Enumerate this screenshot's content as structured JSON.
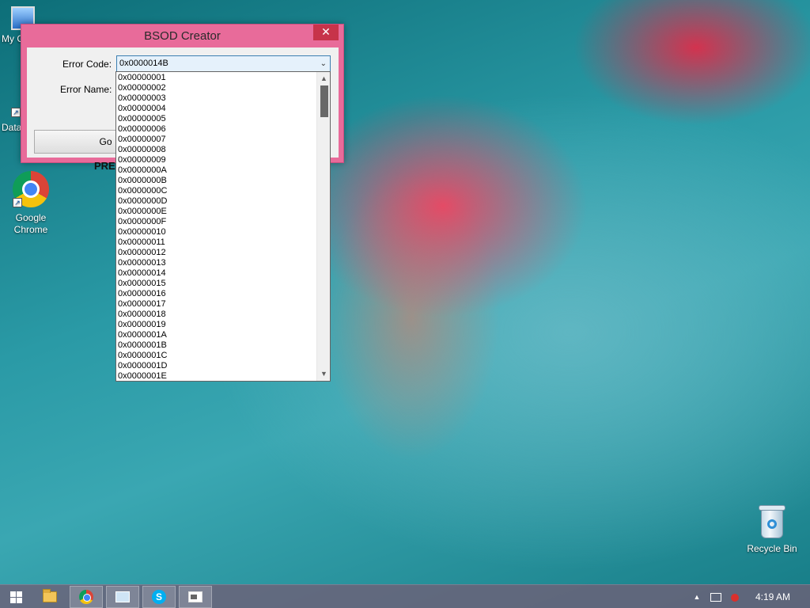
{
  "desktop": {
    "icons": [
      {
        "label": "My C"
      },
      {
        "label": "Data"
      },
      {
        "label": "Google Chrome"
      },
      {
        "label": "Recycle Bin"
      }
    ]
  },
  "window": {
    "title": "BSOD Creator",
    "close_glyph": "✕",
    "error_code_label": "Error Code:",
    "error_name_label": "Error Name:",
    "error_code_value": "0x0000014B",
    "go_label": "Go",
    "press_text": "PRES"
  },
  "dropdown": {
    "items": [
      "0x00000001",
      "0x00000002",
      "0x00000003",
      "0x00000004",
      "0x00000005",
      "0x00000006",
      "0x00000007",
      "0x00000008",
      "0x00000009",
      "0x0000000A",
      "0x0000000B",
      "0x0000000C",
      "0x0000000D",
      "0x0000000E",
      "0x0000000F",
      "0x00000010",
      "0x00000011",
      "0x00000012",
      "0x00000013",
      "0x00000014",
      "0x00000015",
      "0x00000016",
      "0x00000017",
      "0x00000018",
      "0x00000019",
      "0x0000001A",
      "0x0000001B",
      "0x0000001C",
      "0x0000001D",
      "0x0000001E"
    ]
  },
  "taskbar": {
    "clock": "4:19 AM",
    "buttons": [
      "start",
      "file-explorer",
      "chrome",
      "network-app",
      "skype",
      "bsod-creator"
    ]
  },
  "colors": {
    "window_frame": "#e86b9a",
    "close_button": "#c7334a",
    "combo_border": "#3c7fb1"
  }
}
